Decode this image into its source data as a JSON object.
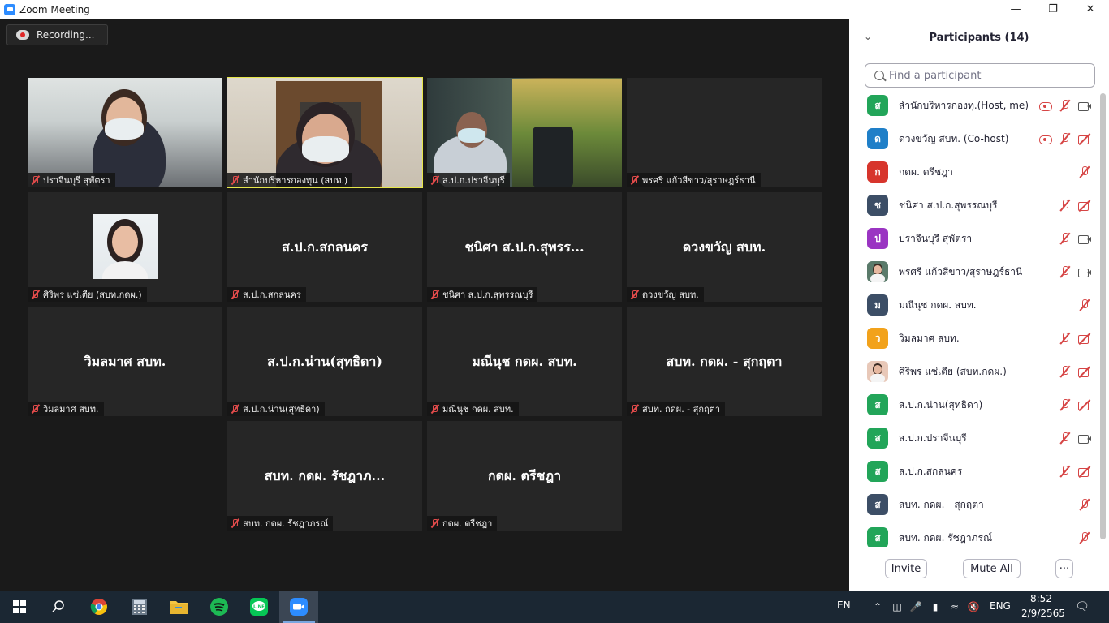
{
  "window": {
    "title": "Zoom Meeting",
    "minimize_icon": "minimize-icon",
    "maximize_icon": "restore-icon",
    "close_icon": "close-icon"
  },
  "recording": {
    "label": "Recording..."
  },
  "tiles": [
    {
      "label": "ปราจีนบุรี  สุพัตรา",
      "video": true,
      "active": false
    },
    {
      "label": "สำนักบริหารกองทุน (สบท.)",
      "video": true,
      "active": true
    },
    {
      "label": "ส.ป.ก.ปราจีนบุรี",
      "video": true,
      "active": false
    },
    {
      "label": "พรศรี แก้วสีขาว/สุราษฎร์ธานี",
      "video": false,
      "active": false,
      "center": ""
    },
    {
      "label": "ศิริพร แซ่เตีย (สบท.กดผ.)",
      "video": false,
      "photo": true,
      "active": false
    },
    {
      "label": "ส.ป.ก.สกลนคร",
      "center": "ส.ป.ก.สกลนคร"
    },
    {
      "label": "ชนิศา ส.ป.ก.สุพรรณบุรี",
      "center": "ชนิศา ส.ป.ก.สุพรร..."
    },
    {
      "label": "ดวงขวัญ สบท.",
      "center": "ดวงขวัญ สบท."
    },
    {
      "label": "วิมลมาศ สบท.",
      "center": "วิมลมาศ สบท."
    },
    {
      "label": "ส.ป.ก.น่าน(สุทธิดา)",
      "center": "ส.ป.ก.น่าน(สุทธิดา)"
    },
    {
      "label": "มณีนุช กดผ. สบท.",
      "center": "มณีนุช กดผ. สบท."
    },
    {
      "label": "สบท. กดผ. - สุกฤตา",
      "center": "สบท. กดผ. - สุกฤตา"
    },
    {
      "label": "สบท. กดผ. รัชฎาภรณ์",
      "center": "สบท. กดผ. รัชฎาภ..."
    },
    {
      "label": "กดผ. ตรีชฎา",
      "center": "กดผ. ตรีชฎา"
    }
  ],
  "participants_panel": {
    "title": "Participants (14)",
    "collapse_icon": "chevron-down-icon",
    "search_placeholder": "Find a participant",
    "participants": [
      {
        "initial": "ส",
        "color": "#22a559",
        "name": "สำนักบริหารกองทุ...",
        "tag": "(Host, me)",
        "icons": [
          "rec",
          "mmute",
          "cam"
        ]
      },
      {
        "initial": "ด",
        "color": "#1f7fc8",
        "name": "ดวงขวัญ สบท. (Co-host)",
        "tag": "",
        "icons": [
          "rec",
          "mmute",
          "camoff"
        ]
      },
      {
        "initial": "ก",
        "color": "#d7352c",
        "name": "กดผ. ตรีชฎา",
        "tag": "",
        "icons": [
          "empty",
          "empty",
          "mmute"
        ]
      },
      {
        "initial": "ช",
        "color": "#3c4e66",
        "name": "ชนิศา ส.ป.ก.สุพรรณบุรี",
        "tag": "",
        "icons": [
          "empty",
          "mmute",
          "camoff"
        ]
      },
      {
        "initial": "ป",
        "color": "#9a34c2",
        "name": "ปราจีนบุรี  สุพัตรา",
        "tag": "",
        "icons": [
          "empty",
          "mmute",
          "cam"
        ]
      },
      {
        "initial": "",
        "color": "#5a7a6a",
        "photo": true,
        "name": "พรศรี แก้วสีขาว/สุราษฎร์ธานี",
        "tag": "",
        "icons": [
          "empty",
          "mmute",
          "cam"
        ]
      },
      {
        "initial": "ม",
        "color": "#3c4e66",
        "name": "มณีนุช กดผ. สบท.",
        "tag": "",
        "icons": [
          "empty",
          "empty",
          "mmute"
        ]
      },
      {
        "initial": "ว",
        "color": "#f2a21b",
        "name": "วิมลมาศ สบท.",
        "tag": "",
        "icons": [
          "empty",
          "mmute",
          "camoff"
        ]
      },
      {
        "initial": "",
        "color": "#e8c8b8",
        "photo": true,
        "name": "ศิริพร แซ่เตีย (สบท.กดผ.)",
        "tag": "",
        "icons": [
          "empty",
          "mmute",
          "camoff"
        ]
      },
      {
        "initial": "ส",
        "color": "#22a559",
        "name": "ส.ป.ก.น่าน(สุทธิดา)",
        "tag": "",
        "icons": [
          "empty",
          "mmute",
          "camoff"
        ]
      },
      {
        "initial": "ส",
        "color": "#22a559",
        "name": "ส.ป.ก.ปราจีนบุรี",
        "tag": "",
        "icons": [
          "empty",
          "mmute",
          "cam"
        ]
      },
      {
        "initial": "ส",
        "color": "#22a559",
        "name": "ส.ป.ก.สกลนคร",
        "tag": "",
        "icons": [
          "empty",
          "mmute",
          "camoff"
        ]
      },
      {
        "initial": "ส",
        "color": "#3c4e66",
        "name": "สบท. กดผ. - สุกฤตา",
        "tag": "",
        "icons": [
          "empty",
          "empty",
          "mmute"
        ]
      },
      {
        "initial": "ส",
        "color": "#22a559",
        "name": "สบท. กดผ. รัชฎาภรณ์",
        "tag": "",
        "icons": [
          "empty",
          "empty",
          "mmute"
        ]
      }
    ],
    "footer": {
      "invite": "Invite",
      "mute_all": "Mute All",
      "more": "···"
    }
  },
  "taskbar": {
    "apps": [
      "start-icon",
      "search-icon",
      "chrome-icon",
      "calculator-icon",
      "file-explorer-icon",
      "spotify-icon",
      "line-icon",
      "zoom-icon"
    ],
    "lang": "EN",
    "input_lang": "ENG",
    "time": "8:52",
    "date": "2/9/2565"
  }
}
